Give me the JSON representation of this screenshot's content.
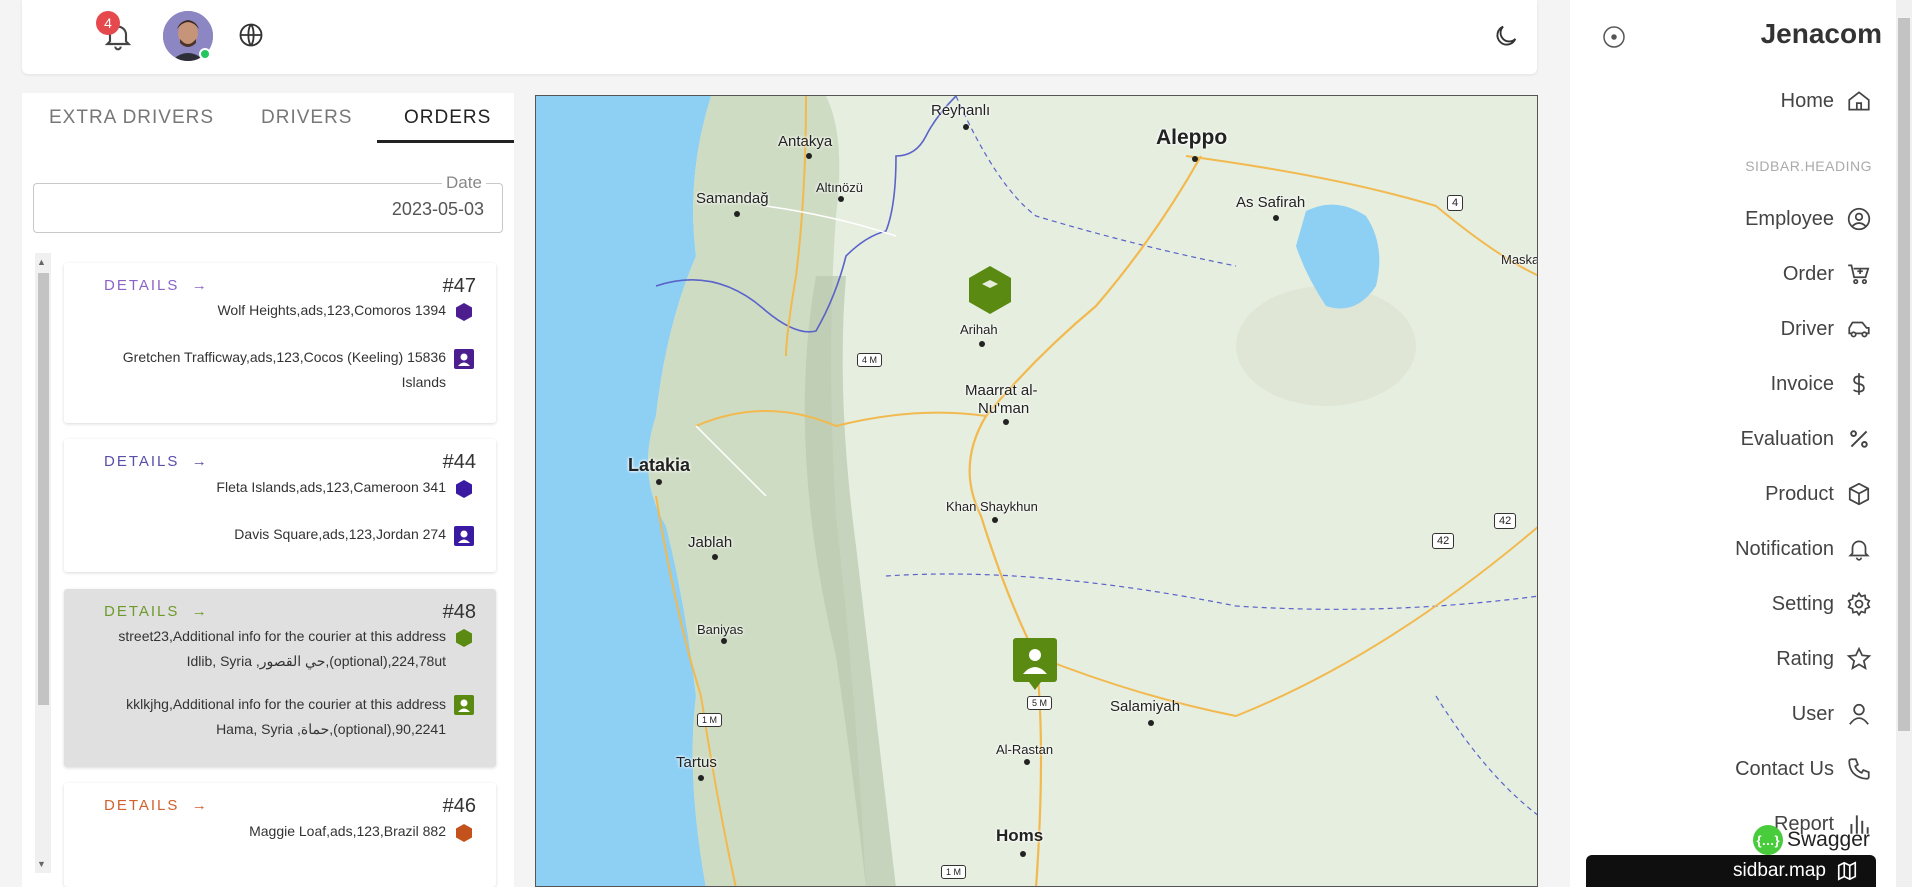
{
  "header": {
    "notification_count": "4",
    "bell_icon": "bell-icon",
    "globe_icon": "globe-icon",
    "theme_icon": "moon-icon"
  },
  "tabs": [
    "EXTRA DRIVERS",
    "DRIVERS",
    "ORDERS"
  ],
  "active_tab": "ORDERS",
  "date_field": {
    "label": "Date",
    "value": "2023-05-03"
  },
  "orders": [
    {
      "id": "#47",
      "details_label": "DETAILS",
      "color": "#8a63c9",
      "pickup": "Wolf Heights,ads,123,Comoros 1394",
      "dropoff_line1": "Gretchen Trafficway,ads,123,Cocos (Keeling) 15836",
      "dropoff_line2": "Islands",
      "icon_color": "#4b1d8f"
    },
    {
      "id": "#44",
      "details_label": "DETAILS",
      "color": "#5a4ea8",
      "pickup": "Fleta Islands,ads,123,Cameroon 341",
      "dropoff_line1": "Davis Square,ads,123,Jordan 274",
      "dropoff_line2": "",
      "icon_color": "#3a1aa0"
    },
    {
      "id": "#48",
      "details_label": "DETAILS",
      "color": "#6e9a2b",
      "pickup_line1": "street23,Additional info for the courier at this address",
      "pickup_line2": "Idlib, Syria ,حي القصور,(optional),224,78ut",
      "dropoff_line1": "kklkjhg,Additional info for the courier at this address",
      "dropoff_line2": "Hama, Syria ,حماة,(optional),90,2241",
      "icon_color": "#5a8a12"
    },
    {
      "id": "#46",
      "details_label": "DETAILS",
      "color": "#d2602c",
      "pickup": "Maggie Loaf,ads,123,Brazil 882",
      "icon_color": "#c4521c"
    }
  ],
  "map": {
    "labels": [
      {
        "text": "Reyhanlı",
        "size": 15
      },
      {
        "text": "Antakya",
        "size": 15
      },
      {
        "text": "Aleppo",
        "size": 21
      },
      {
        "text": "Samandağ",
        "size": 15
      },
      {
        "text": "Altınözü",
        "size": 13
      },
      {
        "text": "As Safirah",
        "size": 15
      },
      {
        "text": "Maska",
        "size": 13
      },
      {
        "text": "Arihah",
        "size": 13
      },
      {
        "text": "Maarrat al-",
        "size": 15
      },
      {
        "text": "Nu'man",
        "size": 15
      },
      {
        "text": "Latakia",
        "size": 18
      },
      {
        "text": "Khan Shaykhun",
        "size": 13
      },
      {
        "text": "Jablah",
        "size": 15
      },
      {
        "text": "Baniyas",
        "size": 13
      },
      {
        "text": "Salamiyah",
        "size": 15
      },
      {
        "text": "Al-Rastan",
        "size": 13
      },
      {
        "text": "Tartus",
        "size": 15
      },
      {
        "text": "Homs",
        "size": 17
      }
    ],
    "road_shields": [
      "4",
      "42",
      "42",
      "4 M",
      "5 M",
      "1 M",
      "1 M"
    ]
  },
  "sidebar": {
    "brand": "Jenacom",
    "heading": "SIDBAR.HEADING",
    "items": [
      {
        "label": "Home",
        "icon": "home-icon"
      },
      {
        "label": "Employee",
        "icon": "user-circle-icon"
      },
      {
        "label": "Order",
        "icon": "cart-icon"
      },
      {
        "label": "Driver",
        "icon": "car-icon"
      },
      {
        "label": "Invoice",
        "icon": "dollar-icon"
      },
      {
        "label": "Evaluation",
        "icon": "percent-icon"
      },
      {
        "label": "Product",
        "icon": "box-icon"
      },
      {
        "label": "Notification",
        "icon": "bell-icon"
      },
      {
        "label": "Setting",
        "icon": "gear-icon"
      },
      {
        "label": "Rating",
        "icon": "star-icon"
      },
      {
        "label": "User",
        "icon": "user-icon"
      },
      {
        "label": "Contact Us",
        "icon": "phone-icon"
      },
      {
        "label": "Report",
        "icon": "bar-chart-icon"
      }
    ],
    "swagger_label": "Swagger",
    "map_button_label": "sidbar.map"
  }
}
